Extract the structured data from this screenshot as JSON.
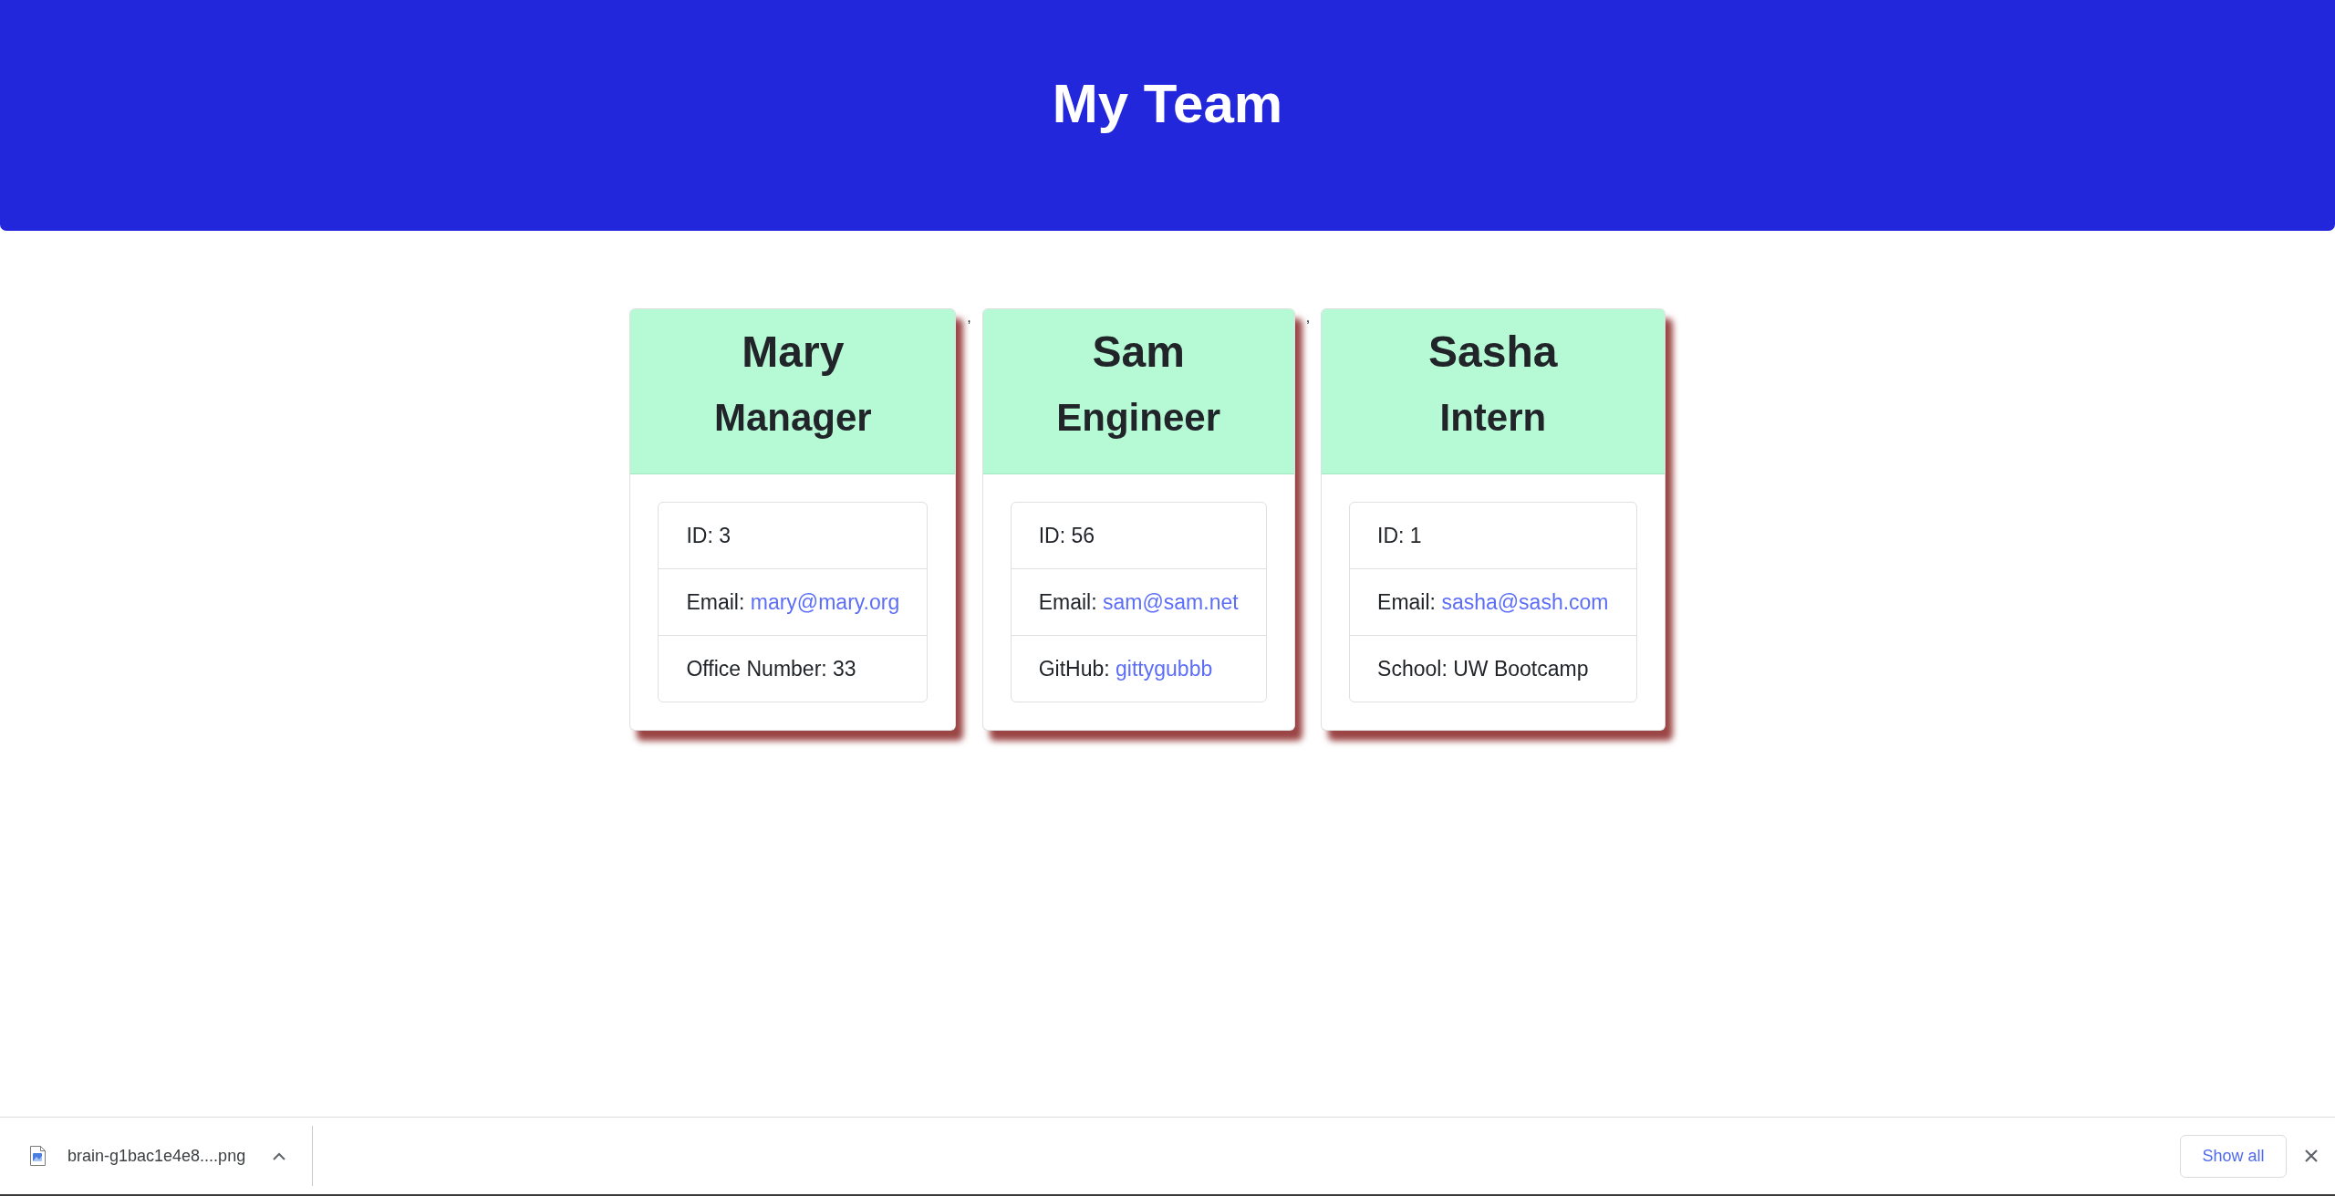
{
  "header": {
    "title": "My Team"
  },
  "cards": [
    {
      "name": "Mary",
      "role": "Manager",
      "details": [
        {
          "kind": "text",
          "label": "ID:",
          "value": "3"
        },
        {
          "kind": "email",
          "label": "Email:",
          "value": "mary@mary.org"
        },
        {
          "kind": "text",
          "label": "Office Number:",
          "value": "33"
        }
      ]
    },
    {
      "name": "Sam",
      "role": "Engineer",
      "details": [
        {
          "kind": "text",
          "label": "ID:",
          "value": "56"
        },
        {
          "kind": "email",
          "label": "Email:",
          "value": "sam@sam.net"
        },
        {
          "kind": "github",
          "label": "GitHub:",
          "value": "gittygubbb"
        }
      ]
    },
    {
      "name": "Sasha",
      "role": "Intern",
      "details": [
        {
          "kind": "text",
          "label": "ID:",
          "value": "1"
        },
        {
          "kind": "email",
          "label": "Email:",
          "value": "sasha@sash.com"
        },
        {
          "kind": "text",
          "label": "School:",
          "value": "UW Bootcamp"
        }
      ]
    }
  ],
  "card_separators": [
    ",",
    ","
  ],
  "download_bar": {
    "file_name": "brain-g1bac1e4e8....png",
    "show_all": "Show all"
  }
}
